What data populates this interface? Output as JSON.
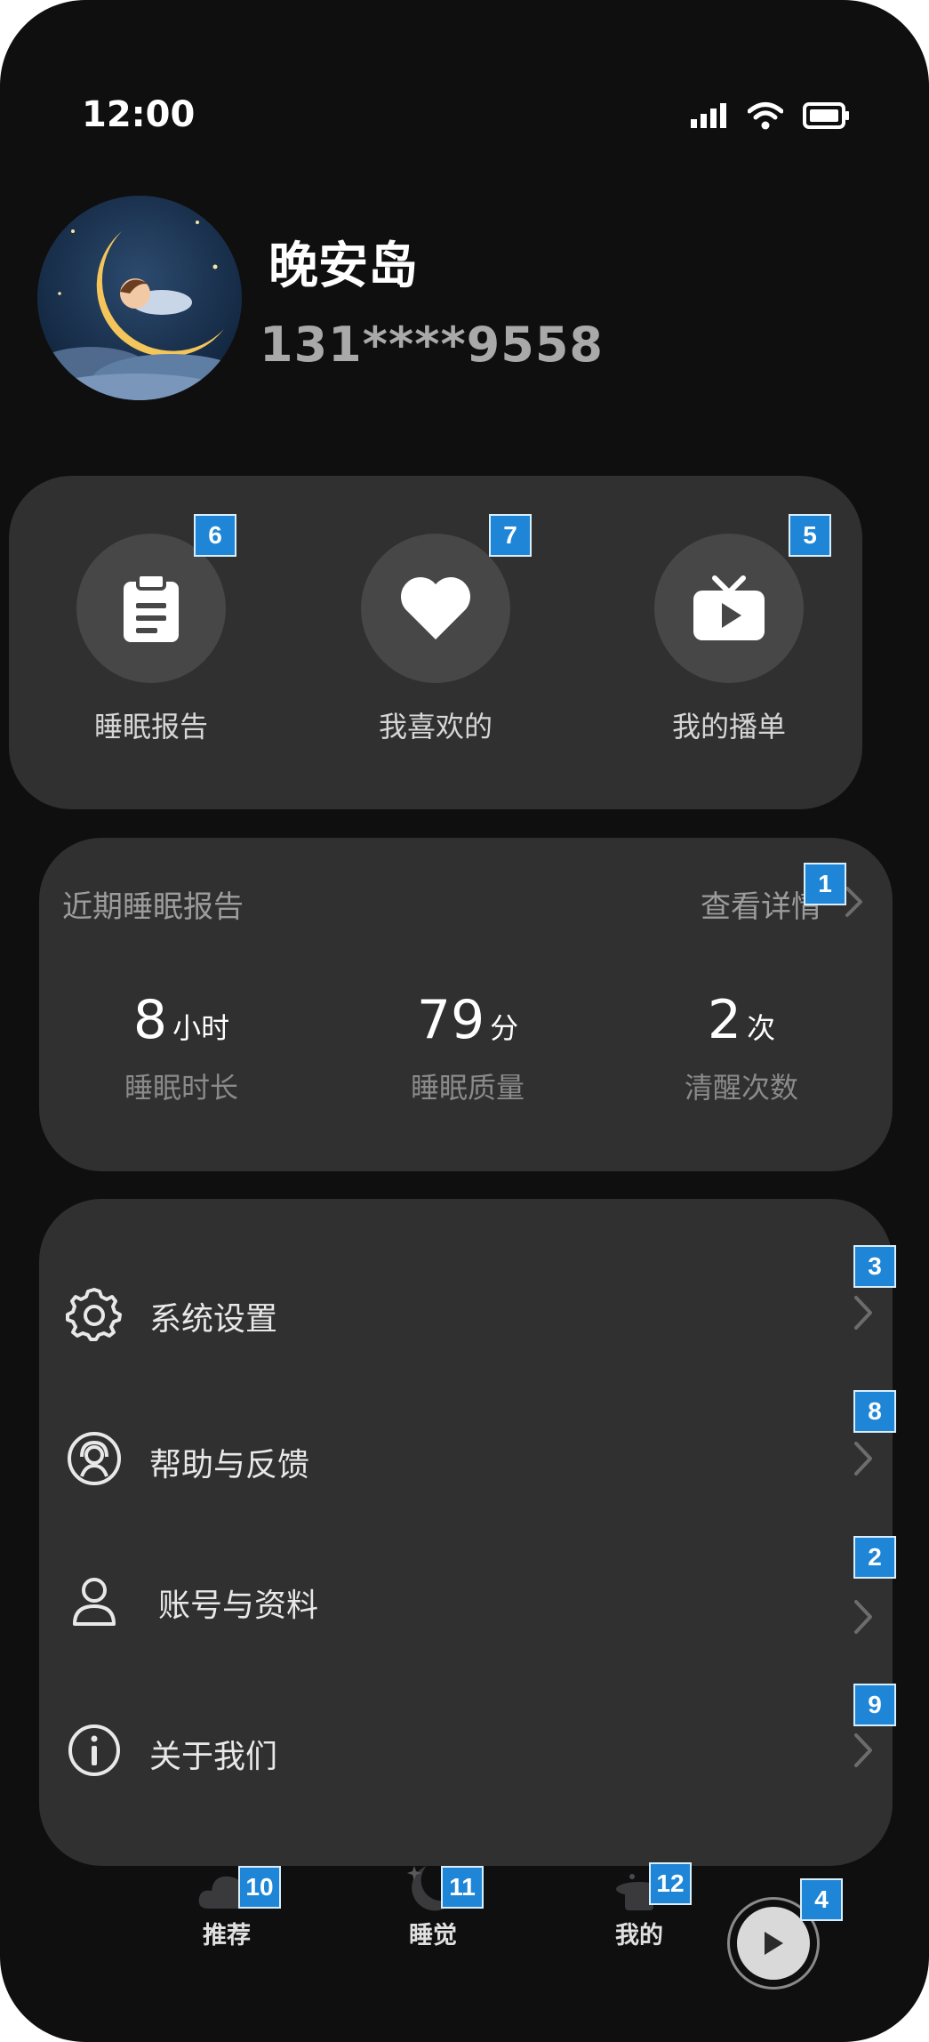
{
  "status_bar": {
    "time": "12:00",
    "icons": [
      "signal-icon",
      "wifi-icon",
      "battery-icon"
    ]
  },
  "profile": {
    "name": "晚安岛",
    "phone": "131****9558"
  },
  "quick_actions": [
    {
      "label": "睡眠报告",
      "icon": "clipboard-icon",
      "badge": "6"
    },
    {
      "label": "我喜欢的",
      "icon": "heart-icon",
      "badge": "7"
    },
    {
      "label": "我的播单",
      "icon": "tv-play-icon",
      "badge": "5"
    }
  ],
  "recent_report": {
    "title": "近期睡眠报告",
    "link": "查看详情",
    "link_badge": "1",
    "stats": [
      {
        "value": "8",
        "unit": "小时",
        "label": "睡眠时长"
      },
      {
        "value": "79",
        "unit": "分",
        "label": "睡眠质量"
      },
      {
        "value": "2",
        "unit": "次",
        "label": "清醒次数"
      }
    ]
  },
  "menu": [
    {
      "label": "系统设置",
      "icon": "gear-icon",
      "badge": "3"
    },
    {
      "label": "帮助与反馈",
      "icon": "support-agent-icon",
      "badge": "8"
    },
    {
      "label": "账号与资料",
      "icon": "user-icon",
      "badge": "2"
    },
    {
      "label": "关于我们",
      "icon": "info-icon",
      "badge": "9"
    }
  ],
  "tab_bar": [
    {
      "label": "推荐",
      "icon": "cloud-icon",
      "badge": "10"
    },
    {
      "label": "睡觉",
      "icon": "moon-icon",
      "badge": "11"
    },
    {
      "label": "我的",
      "icon": "hat-icon",
      "badge": "12"
    }
  ],
  "player": {
    "icon": "play-icon",
    "badge": "4"
  },
  "colors": {
    "background": "#0f0f10",
    "card": "#303031",
    "badge": "#1f86d7"
  }
}
